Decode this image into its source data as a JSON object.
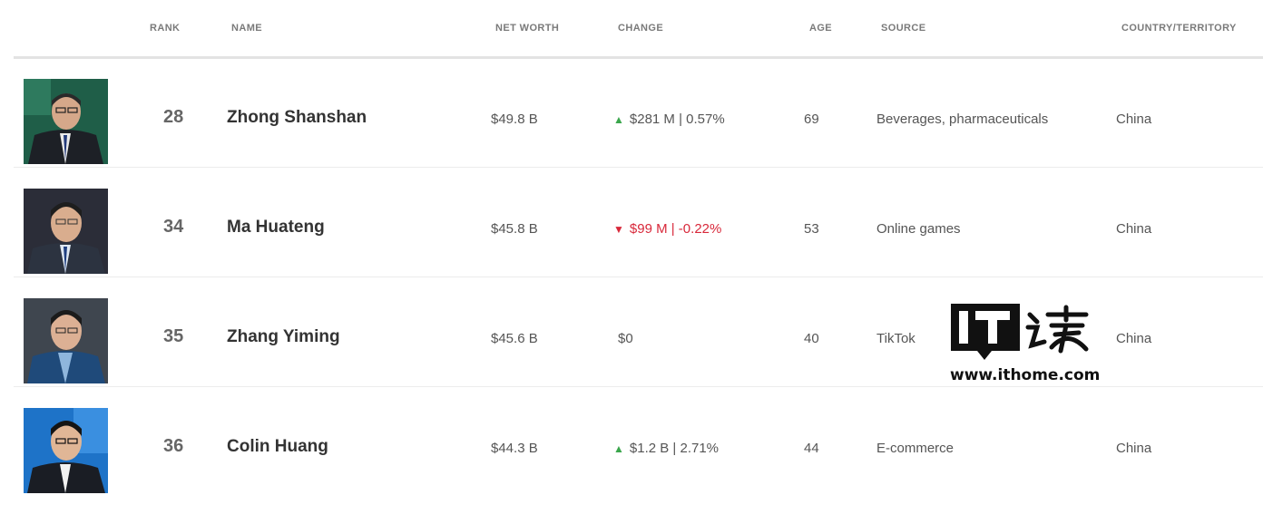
{
  "columns": {
    "rank": "RANK",
    "name": "NAME",
    "net_worth": "NET WORTH",
    "change": "CHANGE",
    "age": "AGE",
    "source": "SOURCE",
    "country": "COUNTRY/TERRITORY"
  },
  "rows": [
    {
      "rank": "28",
      "name": "Zhong Shanshan",
      "net_worth": "$49.8 B",
      "change_dir": "up",
      "change_arrow": "▲",
      "change": "$281 M | 0.57%",
      "age": "69",
      "source": "Beverages, pharmaceuticals",
      "country": "China"
    },
    {
      "rank": "34",
      "name": "Ma Huateng",
      "net_worth": "$45.8 B",
      "change_dir": "down",
      "change_arrow": "▼",
      "change": "$99 M | -0.22%",
      "age": "53",
      "source": "Online games",
      "country": "China"
    },
    {
      "rank": "35",
      "name": "Zhang Yiming",
      "net_worth": "$45.6 B",
      "change_dir": "none",
      "change_arrow": "",
      "change": "$0",
      "age": "40",
      "source": "TikTok",
      "country": "China"
    },
    {
      "rank": "36",
      "name": "Colin Huang",
      "net_worth": "$44.3 B",
      "change_dir": "up",
      "change_arrow": "▲",
      "change": "$1.2 B | 2.71%",
      "age": "44",
      "source": "E-commerce",
      "country": "China"
    }
  ],
  "colors": {
    "up": "#3aa64c",
    "down": "#d8283a"
  },
  "watermark": {
    "logo": "IT之家",
    "url": "www.ithome.com"
  }
}
